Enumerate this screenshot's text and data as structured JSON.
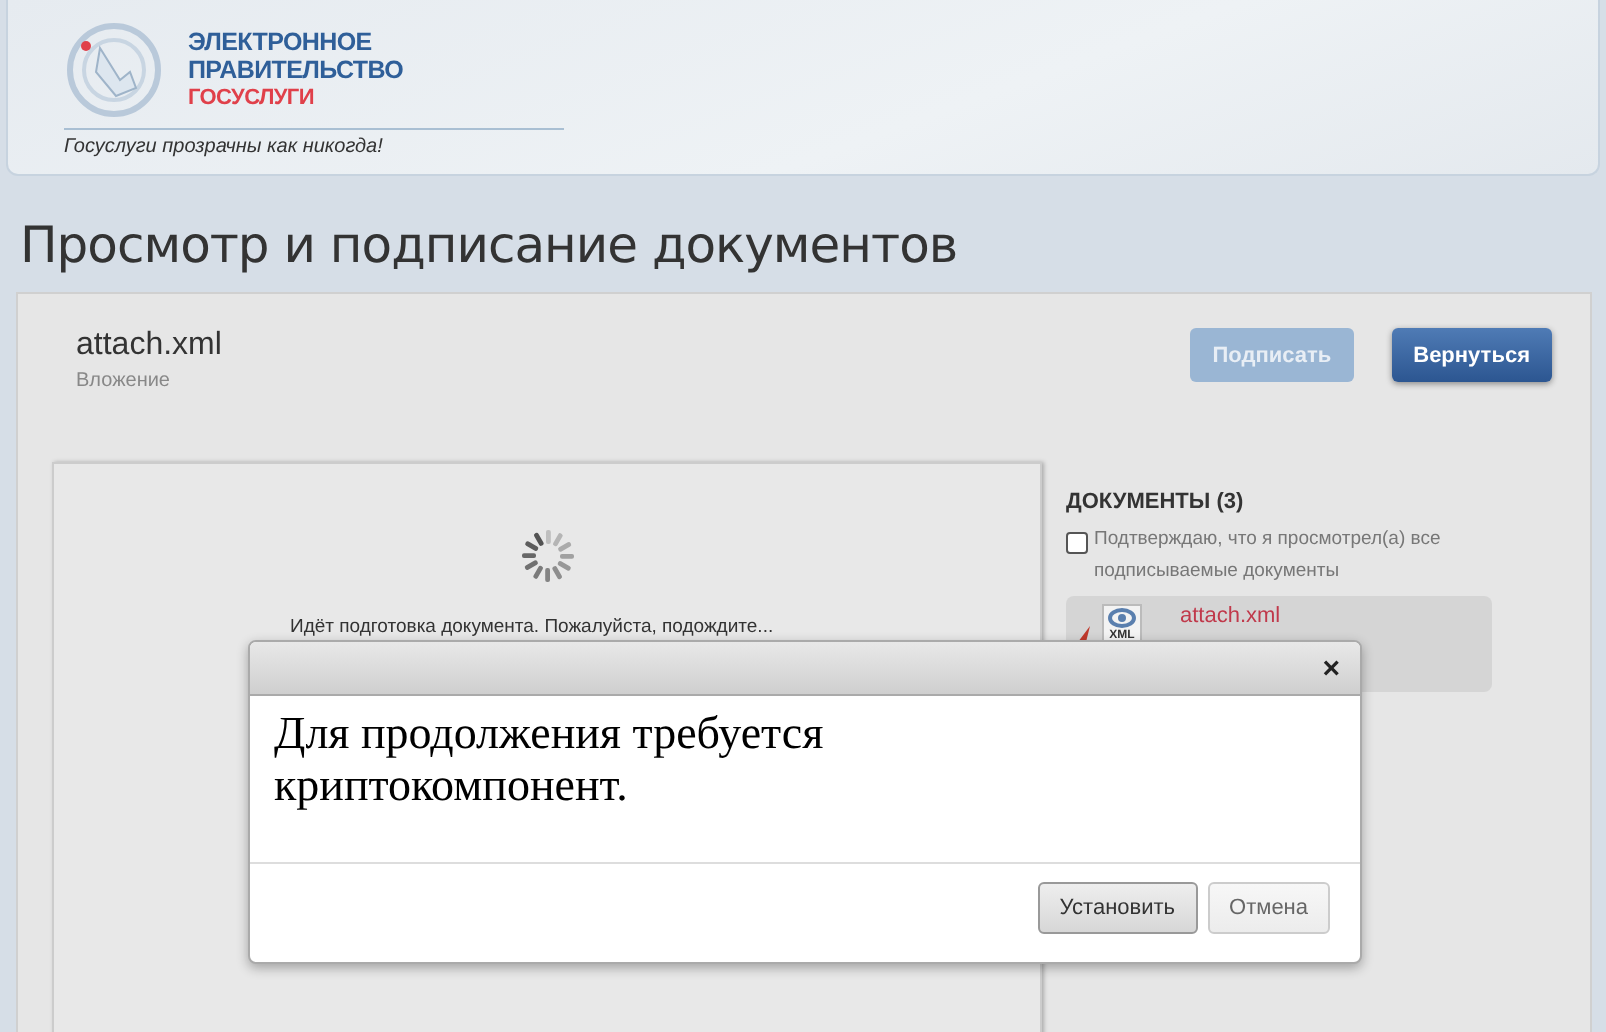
{
  "header": {
    "logo_line_1": "ЭЛЕКТРОННОЕ",
    "logo_line_2": "ПРАВИТЕЛЬСТВО",
    "logo_line_3": "ГОСУСЛУГИ",
    "slogan": "Госуслуги прозрачны как никогда!"
  },
  "page_title": "Просмотр и подписание документов",
  "document": {
    "name": "attach.xml",
    "type": "Вложение"
  },
  "buttons": [
    {
      "label": "Подписать",
      "disabled": true
    },
    {
      "label": "Вернуться",
      "disabled": false
    }
  ],
  "viewer": {
    "message": "Идёт подготовка документа. Пожалуйста, подождите..."
  },
  "documents_panel": {
    "title": "ДОКУМЕНТЫ (3)",
    "confirm": {
      "label": "Подтверждаю, что я просмотрел(а) все подписываемые документы",
      "checked": false
    },
    "items": [
      {
        "name": "attach.xml",
        "icon_label": "XML"
      }
    ]
  },
  "dialog": {
    "message": "Для продолжения требуется криптокомпонент.",
    "close": "×",
    "buttons": [
      {
        "label": "Установить",
        "primary": true
      },
      {
        "label": "Отмена",
        "primary": false
      }
    ]
  }
}
